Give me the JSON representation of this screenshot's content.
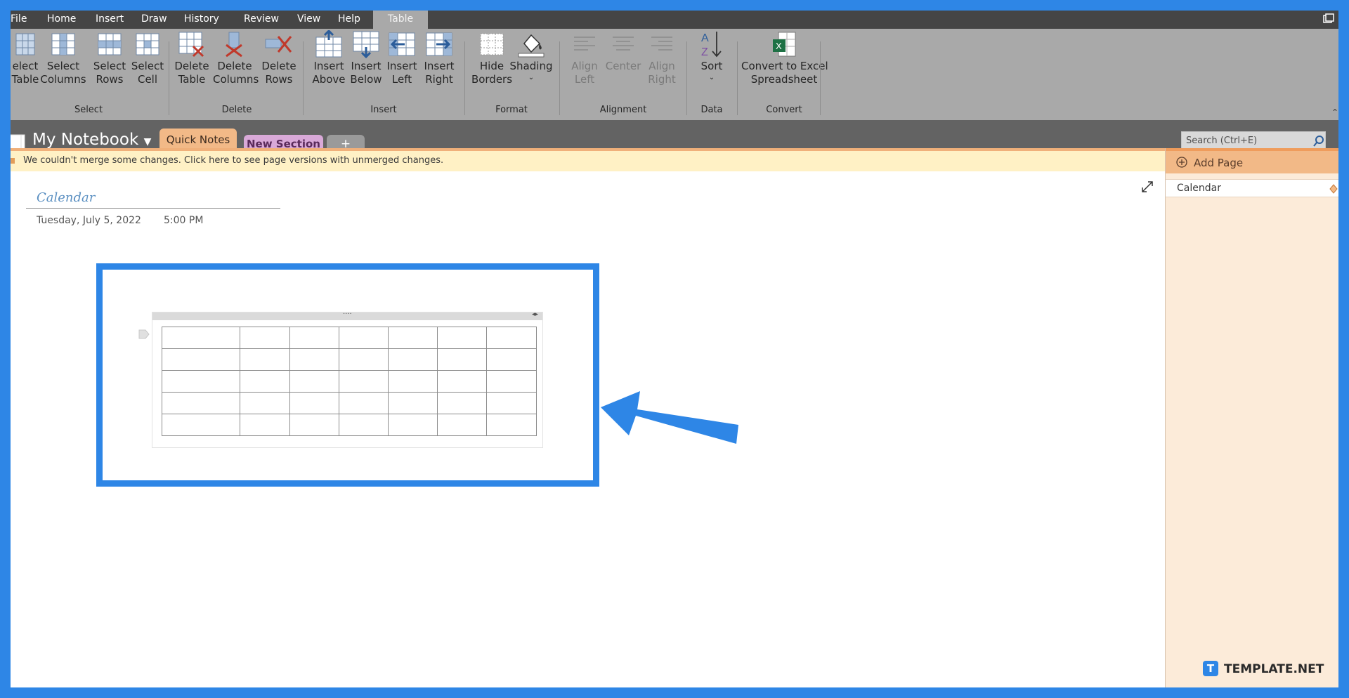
{
  "menu": {
    "file": "File",
    "home": "Home",
    "insert": "Insert",
    "draw": "Draw",
    "history": "History",
    "review": "Review",
    "view": "View",
    "help": "Help",
    "table": "Table"
  },
  "ribbon": {
    "select": {
      "group_label": "Select",
      "table": [
        "elect",
        "Table"
      ],
      "columns": [
        "Select",
        "Columns"
      ],
      "rows": [
        "Select",
        "Rows"
      ],
      "cell": [
        "Select",
        "Cell"
      ]
    },
    "delete": {
      "group_label": "Delete",
      "table": [
        "Delete",
        "Table"
      ],
      "columns": [
        "Delete",
        "Columns"
      ],
      "rows": [
        "Delete",
        "Rows"
      ]
    },
    "insert": {
      "group_label": "Insert",
      "above": [
        "Insert",
        "Above"
      ],
      "below": [
        "Insert",
        "Below"
      ],
      "left": [
        "Insert",
        "Left"
      ],
      "right": [
        "Insert",
        "Right"
      ]
    },
    "format": {
      "group_label": "Format",
      "hide_borders": [
        "Hide",
        "Borders"
      ],
      "shading": "Shading"
    },
    "alignment": {
      "group_label": "Alignment",
      "align_left": [
        "Align",
        "Left"
      ],
      "center": "Center",
      "align_right": [
        "Align",
        "Right"
      ]
    },
    "data": {
      "group_label": "Data",
      "sort": "Sort"
    },
    "convert": {
      "group_label": "Convert",
      "excel": [
        "Convert to Excel",
        "Spreadsheet"
      ]
    }
  },
  "notebook": {
    "title": "My Notebook",
    "tabs": [
      "Quick Notes",
      "New Section",
      "+"
    ],
    "search_placeholder": "Search (Ctrl+E)"
  },
  "infobar": {
    "message": "We couldn't merge some changes. Click here to see page versions with unmerged changes."
  },
  "page_panel": {
    "add_page": "Add Page",
    "pages": [
      "Calendar"
    ]
  },
  "page": {
    "title": "Calendar",
    "date": "Tuesday, July 5, 2022",
    "time": "5:00 PM"
  },
  "table": {
    "rows": 5,
    "columns": 7
  },
  "watermark": {
    "text": "TEMPLATE.NET"
  },
  "colors": {
    "frame_border": "#2e86e6",
    "menubar": "#454545",
    "ribbon": "#a9a9a9",
    "section_bar": "#636363",
    "quick_notes_tab": "#f2b987",
    "new_section_tab": "#d9a9d8",
    "infobar": "#fff1c5",
    "page_panel": "#fcebd9",
    "title_blue": "#5a8fc1"
  }
}
